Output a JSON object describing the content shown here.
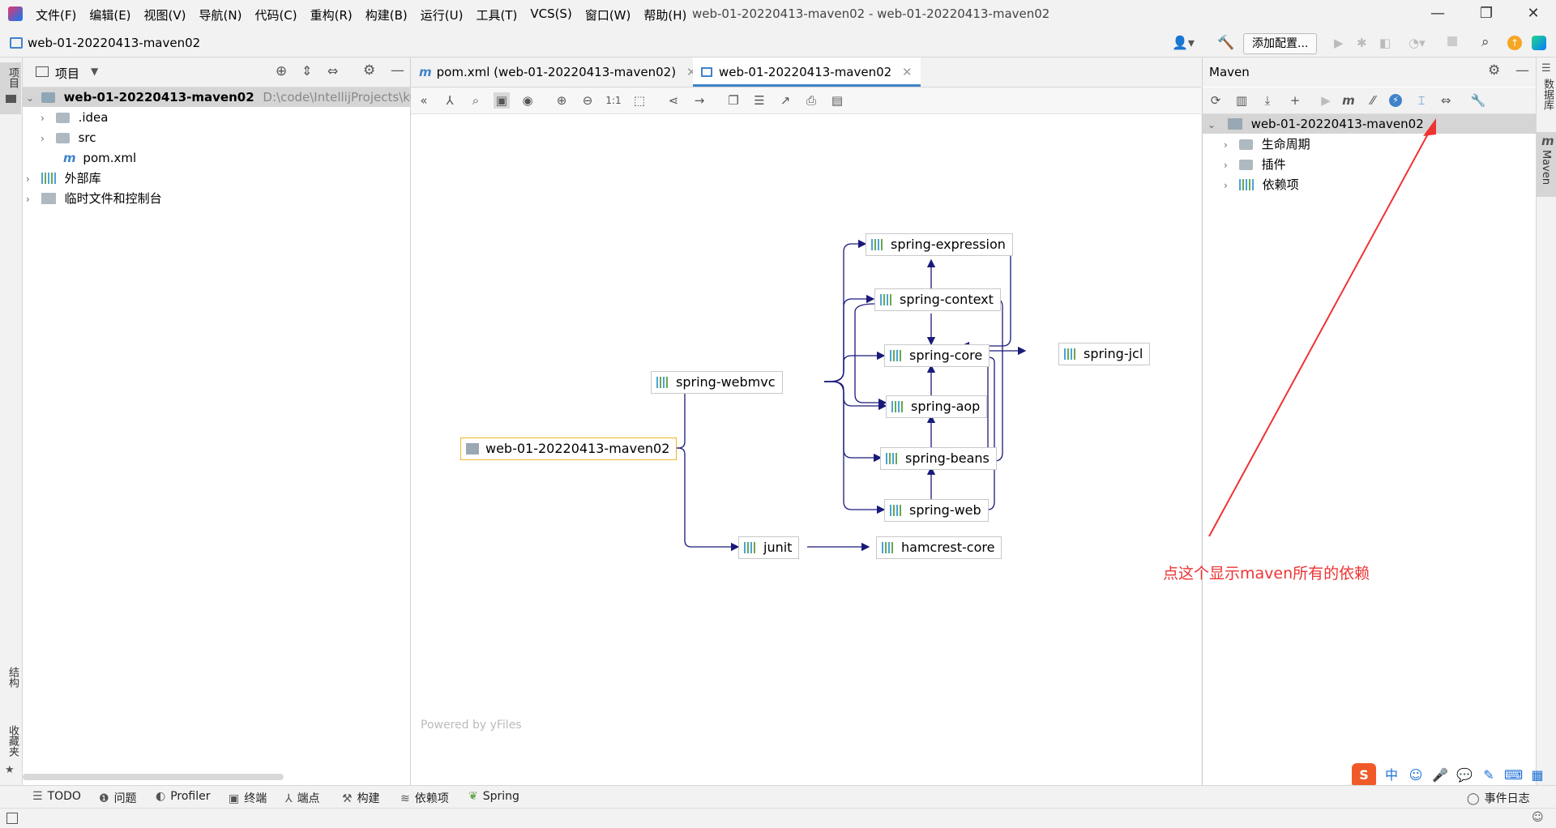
{
  "menubar": {
    "items": [
      "文件(F)",
      "编辑(E)",
      "视图(V)",
      "导航(N)",
      "代码(C)",
      "重构(R)",
      "构建(B)",
      "运行(U)",
      "工具(T)",
      "VCS(S)",
      "窗口(W)",
      "帮助(H)"
    ],
    "window_title": "web-01-20220413-maven02 - web-01-20220413-maven02"
  },
  "navbar": {
    "breadcrumb": "web-01-20220413-maven02",
    "add_config_label": "添加配置..."
  },
  "left_stripe": {
    "project_tab": "项目",
    "structure_tab": "结构",
    "favorites_tab": "收藏夹"
  },
  "project_panel": {
    "title": "项目",
    "root_name": "web-01-20220413-maven02",
    "root_path": "D:\\code\\IntellijProjects\\kua",
    "items": [
      ".idea",
      "src",
      "pom.xml"
    ],
    "external_libs": "外部库",
    "scratches": "临时文件和控制台"
  },
  "editor": {
    "tabs": [
      "pom.xml (web-01-20220413-maven02)",
      "web-01-20220413-maven02"
    ],
    "zoom_label": "1:1",
    "powered_by": "Powered by yFiles"
  },
  "graph": {
    "nodes": {
      "root": "web-01-20220413-maven02",
      "webmvc": "spring-webmvc",
      "expression": "spring-expression",
      "context": "spring-context",
      "core": "spring-core",
      "jcl": "spring-jcl",
      "aop": "spring-aop",
      "beans": "spring-beans",
      "web": "spring-web",
      "junit": "junit",
      "hamcrest": "hamcrest-core"
    }
  },
  "maven_panel": {
    "title": "Maven",
    "project": "web-01-20220413-maven02",
    "children": [
      "生命周期",
      "插件",
      "依赖项"
    ]
  },
  "right_stripe": {
    "database_tab": "数据库",
    "maven_tab": "Maven"
  },
  "annotation": "点这个显示maven所有的依赖",
  "bottom_tools": [
    "TODO",
    "问题",
    "Profiler",
    "终端",
    "端点",
    "构建",
    "依赖项",
    "Spring"
  ],
  "event_log": "事件日志",
  "colors": {
    "accent": "#4083c9",
    "edge": "#1a1a7a",
    "annotation": "#ee3333",
    "root_border": "#f0b429"
  }
}
